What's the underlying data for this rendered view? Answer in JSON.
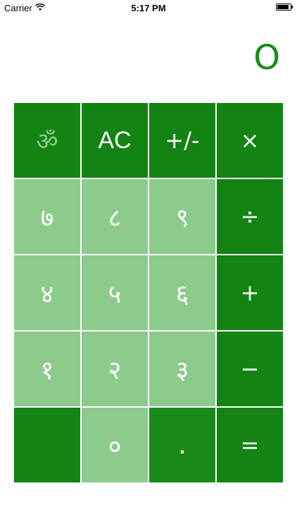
{
  "status_bar": {
    "carrier": "Carrier",
    "time": "5:17 PM"
  },
  "display": {
    "value": "O"
  },
  "keys": {
    "om": "ॐ",
    "ac": "AC",
    "plus_minus": "+/-",
    "multiply": "×",
    "seven": "७",
    "eight": "८",
    "nine": "९",
    "divide": "÷",
    "four": "४",
    "five": "५",
    "six": "६",
    "add": "+",
    "one": "१",
    "two": "२",
    "three": "३",
    "subtract": "−",
    "blank": "",
    "zero": "०",
    "decimal": ".",
    "equals": "="
  },
  "colors": {
    "dark_key": "#138313",
    "light_key": "#8ccb8c",
    "display_text": "#148c14"
  }
}
